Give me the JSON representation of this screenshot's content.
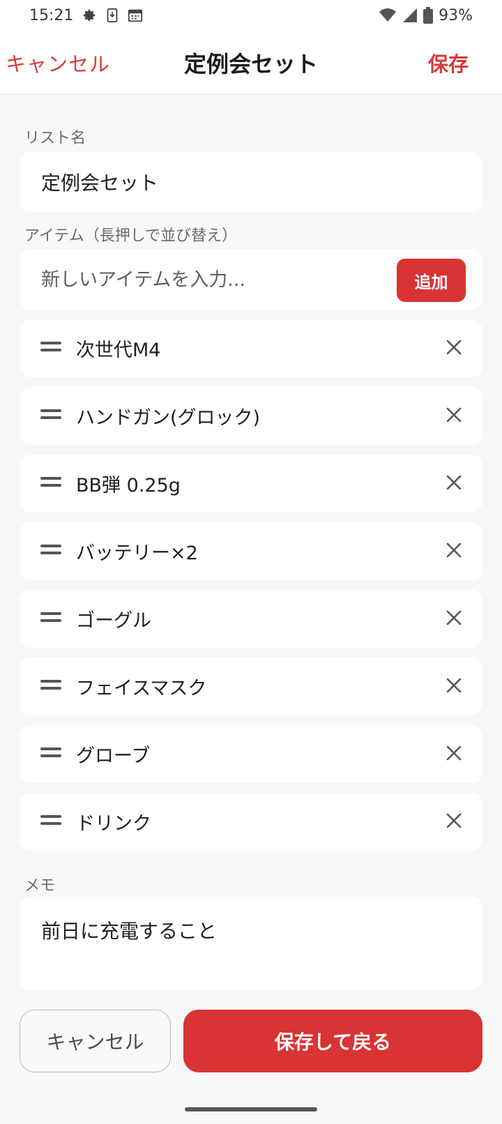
{
  "status_bar": {
    "time": "15:21",
    "battery": "93%",
    "icons": [
      "gear-icon",
      "download-icon",
      "calendar-icon",
      "wifi-icon",
      "signal-icon",
      "battery-icon"
    ]
  },
  "app_bar": {
    "cancel_label": "キャンセル",
    "title": "定例会セット",
    "save_label": "保存"
  },
  "list_name": {
    "label": "リスト名",
    "value": "定例会セット"
  },
  "items_section": {
    "label": "アイテム（長押しで並び替え）",
    "add_placeholder": "新しいアイテムを入力...",
    "add_button": "追加",
    "items": [
      {
        "label": "次世代M4"
      },
      {
        "label": "ハンドガン(グロック)"
      },
      {
        "label": "BB弾 0.25g"
      },
      {
        "label": "バッテリー×2"
      },
      {
        "label": "ゴーグル"
      },
      {
        "label": "フェイスマスク"
      },
      {
        "label": "グローブ"
      },
      {
        "label": "ドリンク"
      }
    ]
  },
  "memo": {
    "label": "メモ",
    "value": "前日に充電すること"
  },
  "bottom_buttons": {
    "cancel_label": "キャンセル",
    "save_back_label": "保存して戻る"
  },
  "colors": {
    "accent": "#d93333",
    "background": "#f8f8f8",
    "card": "#ffffff"
  }
}
